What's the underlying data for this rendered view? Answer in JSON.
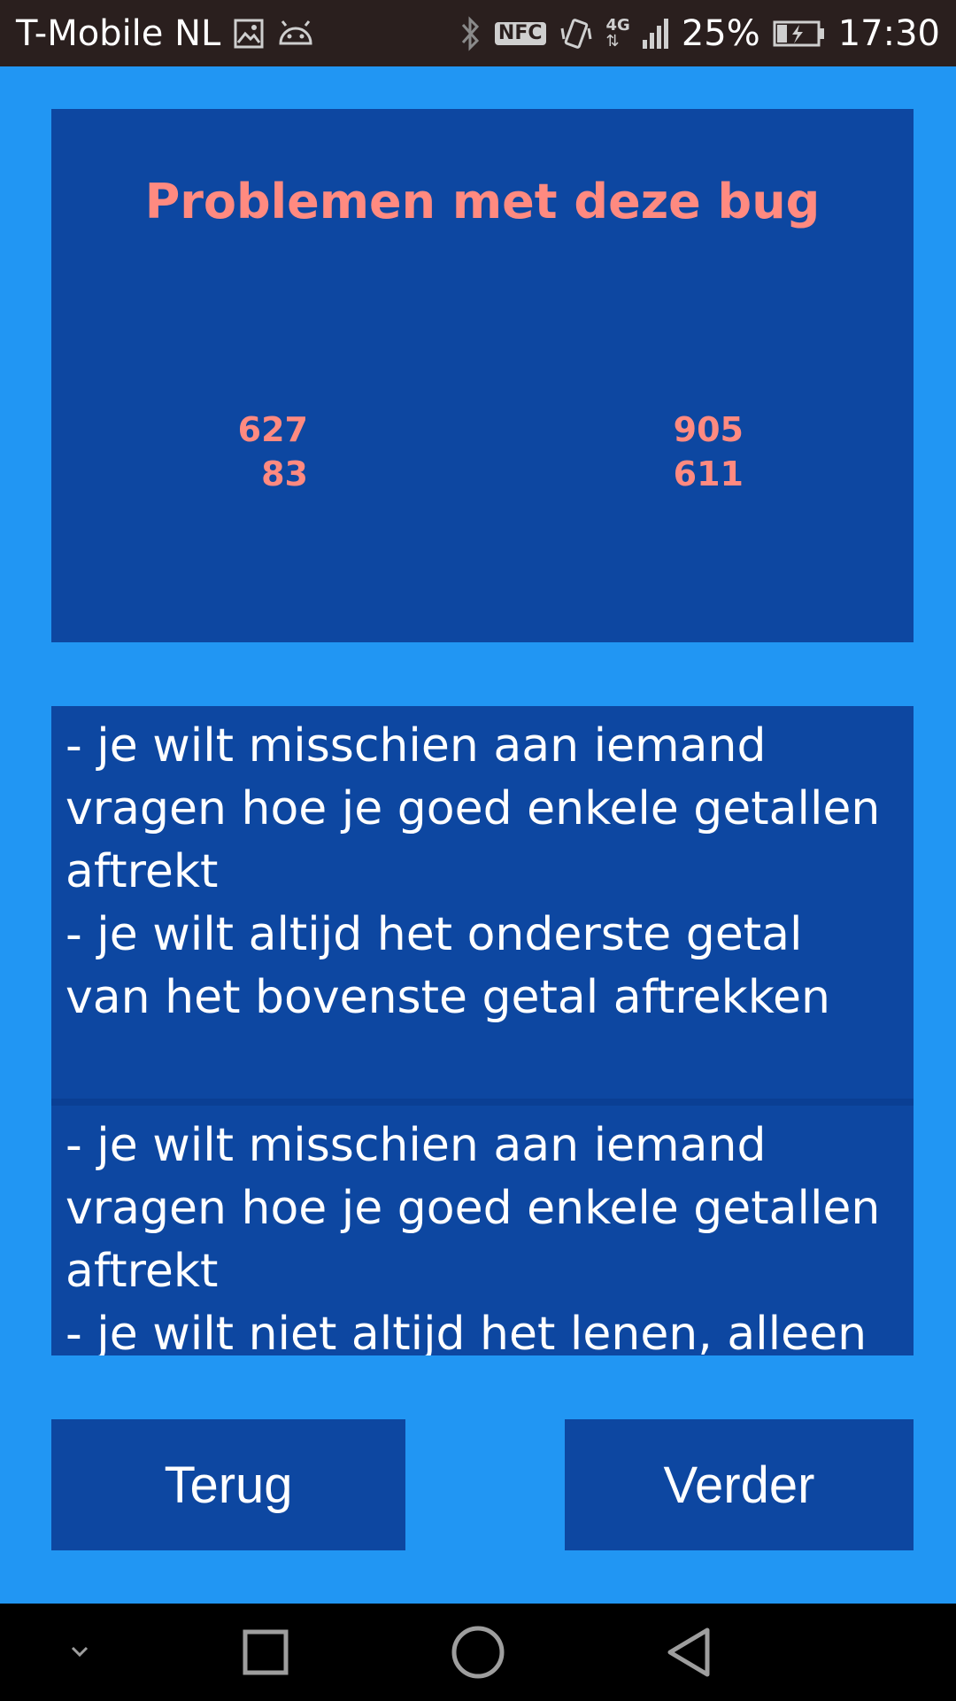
{
  "status_bar": {
    "carrier": "T-Mobile NL",
    "icons_left": [
      "gallery-icon",
      "android-debug-icon"
    ],
    "icons_right": [
      "bluetooth-icon",
      "nfc-icon",
      "vibrate-icon",
      "network-4g-icon",
      "signal-icon"
    ],
    "nfc_label": "NFC",
    "network_label": "4G",
    "battery_percent": "25%",
    "battery_level": 0.25,
    "time": "17:30"
  },
  "problem_card": {
    "title": "Problemen met deze bug",
    "sums": [
      {
        "top": "627",
        "bottom": "83"
      },
      {
        "top": "905",
        "bottom": "611"
      }
    ]
  },
  "hints": [
    {
      "text": "- je wilt misschien aan iemand vragen hoe je goed enkele getallen aftrekt\n- je wilt altijd het onderste getal van het bovenste getal aftrekken"
    },
    {
      "text": "- je wilt misschien aan iemand vragen hoe je goed enkele getallen aftrekt\n- je wilt niet altijd het lenen, alleen"
    }
  ],
  "buttons": {
    "back_label": "Terug",
    "next_label": "Verder"
  },
  "nav_bar": {
    "icons": [
      "chevron-down-icon",
      "recents-square-icon",
      "home-circle-icon",
      "back-triangle-icon"
    ]
  },
  "colors": {
    "background": "#2196F3",
    "card": "#0D47A1",
    "accent_text": "#FF8A80",
    "status_bar": "#2a1f1e"
  }
}
